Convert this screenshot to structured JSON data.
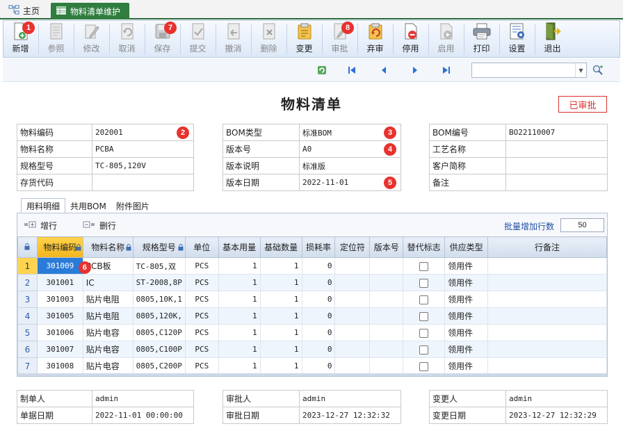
{
  "tabs": {
    "home": "主页",
    "active": "物料清单维护"
  },
  "toolbar": [
    {
      "label": "新增",
      "icon": "new-icon",
      "enabled": true,
      "badge": "1"
    },
    {
      "label": "参照",
      "icon": "reference-icon",
      "enabled": false
    },
    {
      "label": "修改",
      "icon": "edit-icon",
      "enabled": false
    },
    {
      "label": "取消",
      "icon": "cancel-icon",
      "enabled": false
    },
    {
      "label": "保存",
      "icon": "save-icon",
      "enabled": false,
      "badge": "7"
    },
    {
      "label": "提交",
      "icon": "submit-icon",
      "enabled": false
    },
    {
      "label": "撤消",
      "icon": "revoke-icon",
      "enabled": false
    },
    {
      "label": "删除",
      "icon": "delete-icon",
      "enabled": false
    },
    {
      "label": "变更",
      "icon": "change-icon",
      "enabled": true
    },
    {
      "label": "审批",
      "icon": "approve-icon",
      "enabled": false,
      "badge": "8"
    },
    {
      "label": "弃审",
      "icon": "unapprove-icon",
      "enabled": true
    },
    {
      "label": "停用",
      "icon": "disable-icon",
      "enabled": true
    },
    {
      "label": "启用",
      "icon": "enable-icon",
      "enabled": false
    },
    {
      "label": "打印",
      "icon": "print-icon",
      "enabled": true
    },
    {
      "label": "设置",
      "icon": "settings-icon",
      "enabled": true
    },
    {
      "label": "退出",
      "icon": "exit-icon",
      "enabled": true
    }
  ],
  "form": {
    "title": "物料清单",
    "status": "已审批",
    "left": [
      {
        "label": "物料编码",
        "value": "202001",
        "badge": "2"
      },
      {
        "label": "物料名称",
        "value": "PCBA"
      },
      {
        "label": "规格型号",
        "value": "TC-805,120V"
      },
      {
        "label": "存货代码",
        "value": ""
      }
    ],
    "middle": [
      {
        "label": "BOM类型",
        "value": "标准BOM",
        "badge": "3"
      },
      {
        "label": "版本号",
        "value": "A0",
        "badge": "4"
      },
      {
        "label": "版本说明",
        "value": "标准版"
      },
      {
        "label": "版本日期",
        "value": "2022-11-01",
        "badge": "5"
      }
    ],
    "right": [
      {
        "label": "BOM编号",
        "value": "BO22110007"
      },
      {
        "label": "工艺名称",
        "value": ""
      },
      {
        "label": "客户简称",
        "value": ""
      },
      {
        "label": "备注",
        "value": ""
      }
    ]
  },
  "subtabs": [
    "用料明细",
    "共用BOM",
    "附件图片"
  ],
  "grid_toolbar": {
    "add_row": "增行",
    "delete_row": "删行",
    "batch_label": "批量增加行数",
    "batch_value": "50"
  },
  "grid": {
    "columns": [
      "物料编码",
      "物料名称",
      "规格型号",
      "单位",
      "基本用量",
      "基础数量",
      "损耗率",
      "定位符",
      "版本号",
      "替代标志",
      "供应类型",
      "行备注"
    ],
    "rows": [
      {
        "n": "1",
        "code": "301009",
        "name": "PCB板",
        "spec": "TC-805,双",
        "unit": "PCS",
        "qty": "1",
        "base": "1",
        "loss": "0",
        "supply": "领用件"
      },
      {
        "n": "2",
        "code": "301001",
        "name": "IC",
        "spec": "ST-2008,8P",
        "unit": "PCS",
        "qty": "1",
        "base": "1",
        "loss": "0",
        "supply": "领用件"
      },
      {
        "n": "3",
        "code": "301003",
        "name": "贴片电阻",
        "spec": "0805,10K,1",
        "unit": "PCS",
        "qty": "1",
        "base": "1",
        "loss": "0",
        "supply": "领用件"
      },
      {
        "n": "4",
        "code": "301005",
        "name": "贴片电阻",
        "spec": "0805,120K,",
        "unit": "PCS",
        "qty": "1",
        "base": "1",
        "loss": "0",
        "supply": "领用件"
      },
      {
        "n": "5",
        "code": "301006",
        "name": "贴片电容",
        "spec": "0805,C120P",
        "unit": "PCS",
        "qty": "1",
        "base": "1",
        "loss": "0",
        "supply": "领用件"
      },
      {
        "n": "6",
        "code": "301007",
        "name": "贴片电容",
        "spec": "0805,C100P",
        "unit": "PCS",
        "qty": "1",
        "base": "1",
        "loss": "0",
        "supply": "领用件"
      },
      {
        "n": "7",
        "code": "301008",
        "name": "贴片电容",
        "spec": "0805,C200P",
        "unit": "PCS",
        "qty": "1",
        "base": "1",
        "loss": "0",
        "supply": "领用件"
      }
    ],
    "selected_badge": "6"
  },
  "footer": {
    "left": [
      {
        "label": "制单人",
        "value": "admin"
      },
      {
        "label": "单据日期",
        "value": "2022-11-01 00:00:00"
      }
    ],
    "middle": [
      {
        "label": "审批人",
        "value": "admin"
      },
      {
        "label": "审批日期",
        "value": "2023-12-27 12:32:32"
      }
    ],
    "right": [
      {
        "label": "变更人",
        "value": "admin"
      },
      {
        "label": "变更日期",
        "value": "2023-12-27 12:32:29"
      }
    ]
  },
  "colors": {
    "brand_green": "#2f7d3f",
    "badge_red": "#e8322e",
    "status_red": "#d93030",
    "selection_blue": "#2b7cd8",
    "key_yellow": "#ffd34d"
  }
}
